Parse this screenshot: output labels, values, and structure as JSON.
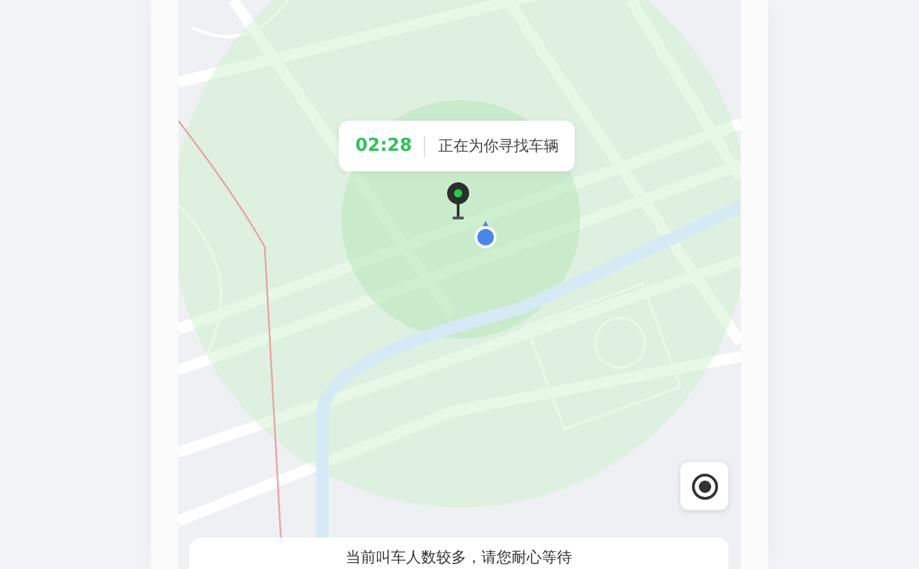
{
  "search_status": {
    "elapsed": "02:28",
    "message": "正在为你寻找车辆"
  },
  "notice": {
    "text": "当前叫车人数较多，请您耐心等待"
  }
}
